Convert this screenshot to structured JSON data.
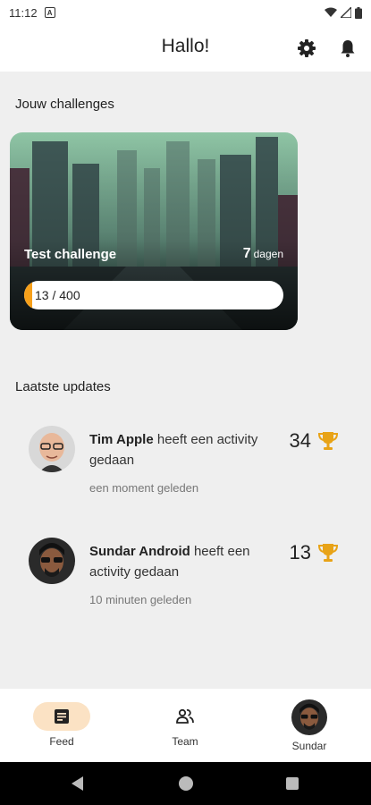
{
  "status_bar": {
    "time": "11:12",
    "notification_icon": "a-icon"
  },
  "app_bar": {
    "title": "Hallo!",
    "settings_icon": "gear-icon",
    "notification_icon": "bell-icon"
  },
  "challenges": {
    "section_title": "Jouw challenges",
    "items": [
      {
        "name": "Test challenge",
        "days_value": "7",
        "days_unit": "dagen",
        "progress_label": "13 / 400",
        "progress_fraction": 0.0325
      }
    ]
  },
  "updates": {
    "section_title": "Laatste updates",
    "items": [
      {
        "user": "Tim Apple",
        "action": "heeft een activity gedaan",
        "time": "een moment geleden",
        "score": "34",
        "score_icon": "trophy-icon"
      },
      {
        "user": "Sundar Android",
        "action": "heeft een activity gedaan",
        "time": "10 minuten geleden",
        "score": "13",
        "score_icon": "trophy-icon"
      }
    ]
  },
  "bottom_nav": {
    "items": [
      {
        "label": "Feed",
        "icon": "feed-icon",
        "active": true
      },
      {
        "label": "Team",
        "icon": "team-icon",
        "active": false
      },
      {
        "label": "Sundar",
        "icon": "avatar",
        "active": false
      }
    ]
  },
  "colors": {
    "accent": "#f7a01a",
    "accent_soft": "#fbe2c4",
    "trophy": "#e8a317"
  }
}
